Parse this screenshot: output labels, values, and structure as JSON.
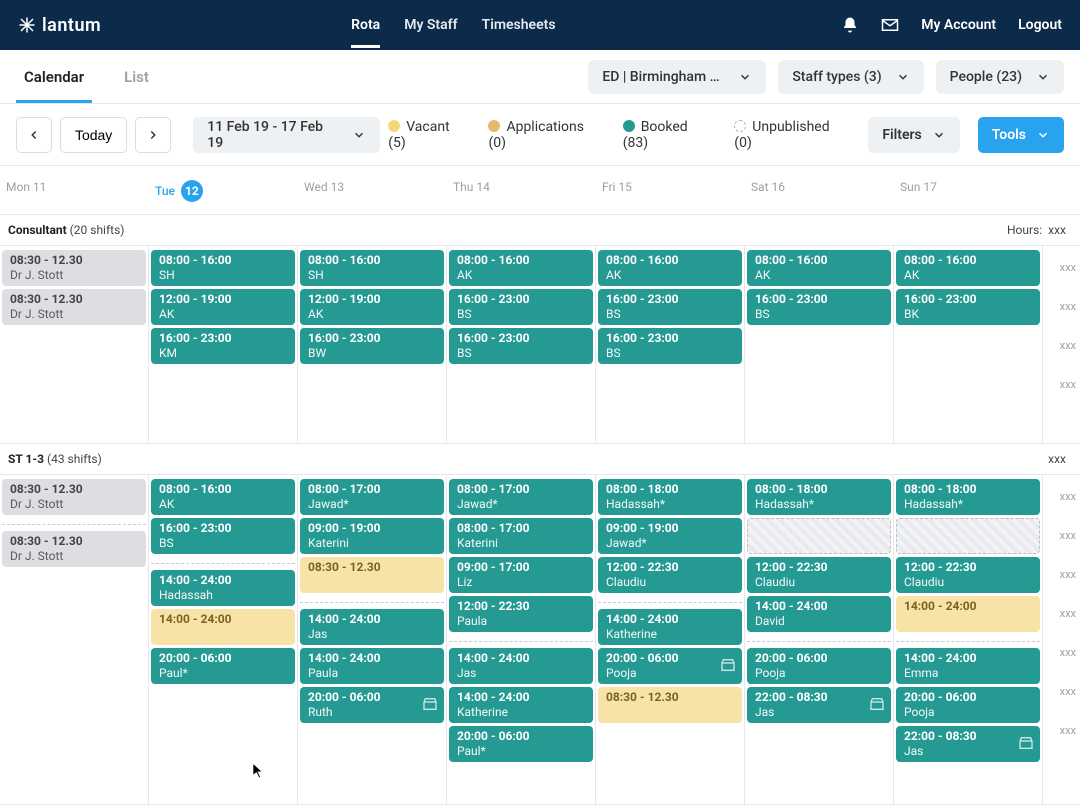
{
  "brand": "lantum",
  "nav": {
    "rota": "Rota",
    "mystaff": "My Staff",
    "timesheets": "Timesheets"
  },
  "top_right": {
    "my_account": "My Account",
    "logout": "Logout"
  },
  "subtabs": {
    "calendar": "Calendar",
    "list": "List"
  },
  "filters": {
    "location": "ED | Birmingham C...",
    "staff_types": "Staff types (3)",
    "people": "People (23)"
  },
  "toolbar": {
    "today": "Today",
    "range": "11 Feb 19 - 17 Feb 19",
    "filters_label": "Filters",
    "tools_label": "Tools"
  },
  "legend": {
    "vacant": {
      "label": "Vacant (5)",
      "color": "#f5d77a"
    },
    "applications": {
      "label": "Applications (0)",
      "color": "#e8b86d"
    },
    "booked": {
      "label": "Booked (83)",
      "color": "#259a93"
    },
    "unpublished": {
      "label": "Unpublished (0)",
      "color": "#ffffff"
    }
  },
  "days": [
    {
      "label": "Mon 11",
      "num": "11"
    },
    {
      "label": "Tue",
      "num": "12",
      "selected": true
    },
    {
      "label": "Wed 13",
      "num": "13"
    },
    {
      "label": "Thu 14",
      "num": "14"
    },
    {
      "label": "Fri 15",
      "num": "15"
    },
    {
      "label": "Sat 16",
      "num": "16"
    },
    {
      "label": "Sun 17",
      "num": "17"
    }
  ],
  "sections": {
    "consultant": {
      "title": "Consultant",
      "count": "(20 shifts)",
      "hours_label": "Hours:",
      "hours_val": "xxx"
    },
    "st13": {
      "title": "ST 1-3",
      "count": "(43 shifts)",
      "hours_val": "xxx"
    }
  },
  "hours_filler": "xxx",
  "consultant": {
    "mon": [
      {
        "t": "08:30 - 12.30",
        "w": "Dr J. Stott",
        "k": "grey"
      },
      {
        "t": "08:30 - 12.30",
        "w": "Dr J. Stott",
        "k": "grey"
      }
    ],
    "tue": [
      {
        "t": "08:00 - 16:00",
        "w": "SH",
        "k": "booked"
      },
      {
        "t": "12:00 - 19:00",
        "w": "AK",
        "k": "booked"
      },
      {
        "t": "16:00 - 23:00",
        "w": "KM",
        "k": "booked"
      }
    ],
    "wed": [
      {
        "t": "08:00 - 16:00",
        "w": "SH",
        "k": "booked"
      },
      {
        "t": "12:00 - 19:00",
        "w": "AK",
        "k": "booked"
      },
      {
        "t": "16:00 - 23:00",
        "w": "BW",
        "k": "booked"
      }
    ],
    "thu": [
      {
        "t": "08:00 - 16:00",
        "w": "AK",
        "k": "booked"
      },
      {
        "t": "16:00 - 23:00",
        "w": "BS",
        "k": "booked"
      },
      {
        "t": "16:00 - 23:00",
        "w": "BS",
        "k": "booked"
      }
    ],
    "fri": [
      {
        "t": "08:00 - 16:00",
        "w": "AK",
        "k": "booked"
      },
      {
        "t": "16:00 - 23:00",
        "w": "BS",
        "k": "booked"
      },
      {
        "t": "16:00 - 23:00",
        "w": "BS",
        "k": "booked"
      }
    ],
    "sat": [
      {
        "t": "08:00 - 16:00",
        "w": "AK",
        "k": "booked"
      },
      {
        "t": "16:00 - 23:00",
        "w": "BS",
        "k": "booked"
      }
    ],
    "sun": [
      {
        "t": "08:00 - 16:00",
        "w": "AK",
        "k": "booked"
      },
      {
        "t": "16:00 - 23:00",
        "w": "BK",
        "k": "booked"
      }
    ]
  },
  "st": {
    "mon_a": [
      {
        "t": "08:30 - 12.30",
        "w": "Dr J. Stott",
        "k": "grey"
      }
    ],
    "tue_a": [
      {
        "t": "08:00 - 16:00",
        "w": "AK",
        "k": "booked"
      },
      {
        "t": "16:00 - 23:00",
        "w": "BS",
        "k": "booked"
      }
    ],
    "wed_a": [
      {
        "t": "08:00 - 17:00",
        "w": "Jawad*",
        "k": "booked"
      },
      {
        "t": "09:00 - 19:00",
        "w": "Katerini",
        "k": "booked"
      },
      {
        "t": "08:30 - 12.30",
        "w": "",
        "k": "vacant"
      }
    ],
    "thu_a": [
      {
        "t": "08:00 - 17:00",
        "w": "Jawad*",
        "k": "booked"
      },
      {
        "t": "08:00 - 17:00",
        "w": "Katerini",
        "k": "booked"
      },
      {
        "t": "09:00 - 17:00",
        "w": "Liz",
        "k": "booked"
      },
      {
        "t": "12:00 - 22:30",
        "w": "Paula",
        "k": "booked"
      }
    ],
    "fri_a": [
      {
        "t": "08:00 - 18:00",
        "w": "Hadassah*",
        "k": "booked"
      },
      {
        "t": "09:00 - 19:00",
        "w": "Jawad*",
        "k": "booked"
      },
      {
        "t": "12:00 - 22:30",
        "w": "Claudiu",
        "k": "booked"
      }
    ],
    "sat_a": [
      {
        "t": "08:00 - 18:00",
        "w": "Hadassah*",
        "k": "booked"
      },
      {
        "t": "",
        "w": "",
        "k": "unpub"
      },
      {
        "t": "12:00 - 22:30",
        "w": "Claudiu",
        "k": "booked"
      },
      {
        "t": "14:00 - 24:00",
        "w": "David",
        "k": "booked"
      }
    ],
    "sun_a": [
      {
        "t": "08:00 - 18:00",
        "w": "Hadassah*",
        "k": "booked"
      },
      {
        "t": "",
        "w": "",
        "k": "unpub"
      },
      {
        "t": "12:00 - 22:30",
        "w": "Claudiu",
        "k": "booked"
      },
      {
        "t": "14:00 - 24:00",
        "w": "",
        "k": "vacant"
      }
    ],
    "mon_b": [
      {
        "t": "08:30 - 12.30",
        "w": "Dr J. Stott",
        "k": "grey"
      }
    ],
    "tue_b": [
      {
        "t": "14:00 - 24:00",
        "w": "Hadassah",
        "k": "booked"
      },
      {
        "t": "14:00 - 24:00",
        "w": "",
        "k": "vacant"
      },
      {
        "t": "20:00 - 06:00",
        "w": "Paul*",
        "k": "booked"
      }
    ],
    "wed_b": [
      {
        "t": "14:00 - 24:00",
        "w": "Jas",
        "k": "booked"
      },
      {
        "t": "14:00 - 24:00",
        "w": "Paula",
        "k": "booked"
      },
      {
        "t": "20:00 - 06:00",
        "w": "Ruth",
        "k": "booked",
        "store": true
      }
    ],
    "thu_b": [
      {
        "t": "14:00 - 24:00",
        "w": "Jas",
        "k": "booked"
      },
      {
        "t": "14:00 - 24:00",
        "w": "Katherine",
        "k": "booked"
      },
      {
        "t": "20:00 - 06:00",
        "w": "Paul*",
        "k": "booked"
      }
    ],
    "fri_b": [
      {
        "t": "14:00 - 24:00",
        "w": "Katherine",
        "k": "booked"
      },
      {
        "t": "20:00 - 06:00",
        "w": "Pooja",
        "k": "booked",
        "store": true
      },
      {
        "t": "08:30 - 12.30",
        "w": "",
        "k": "vacant"
      }
    ],
    "sat_b": [
      {
        "t": "20:00 - 06:00",
        "w": "Pooja",
        "k": "booked"
      },
      {
        "t": "22:00 - 08:30",
        "w": "Jas",
        "k": "booked",
        "store": true
      }
    ],
    "sun_b": [
      {
        "t": "14:00 - 24:00",
        "w": "Emma",
        "k": "booked"
      },
      {
        "t": "20:00 - 06:00",
        "w": "Pooja",
        "k": "booked"
      },
      {
        "t": "22:00 - 08:30",
        "w": "Jas",
        "k": "booked",
        "store": true
      }
    ]
  }
}
